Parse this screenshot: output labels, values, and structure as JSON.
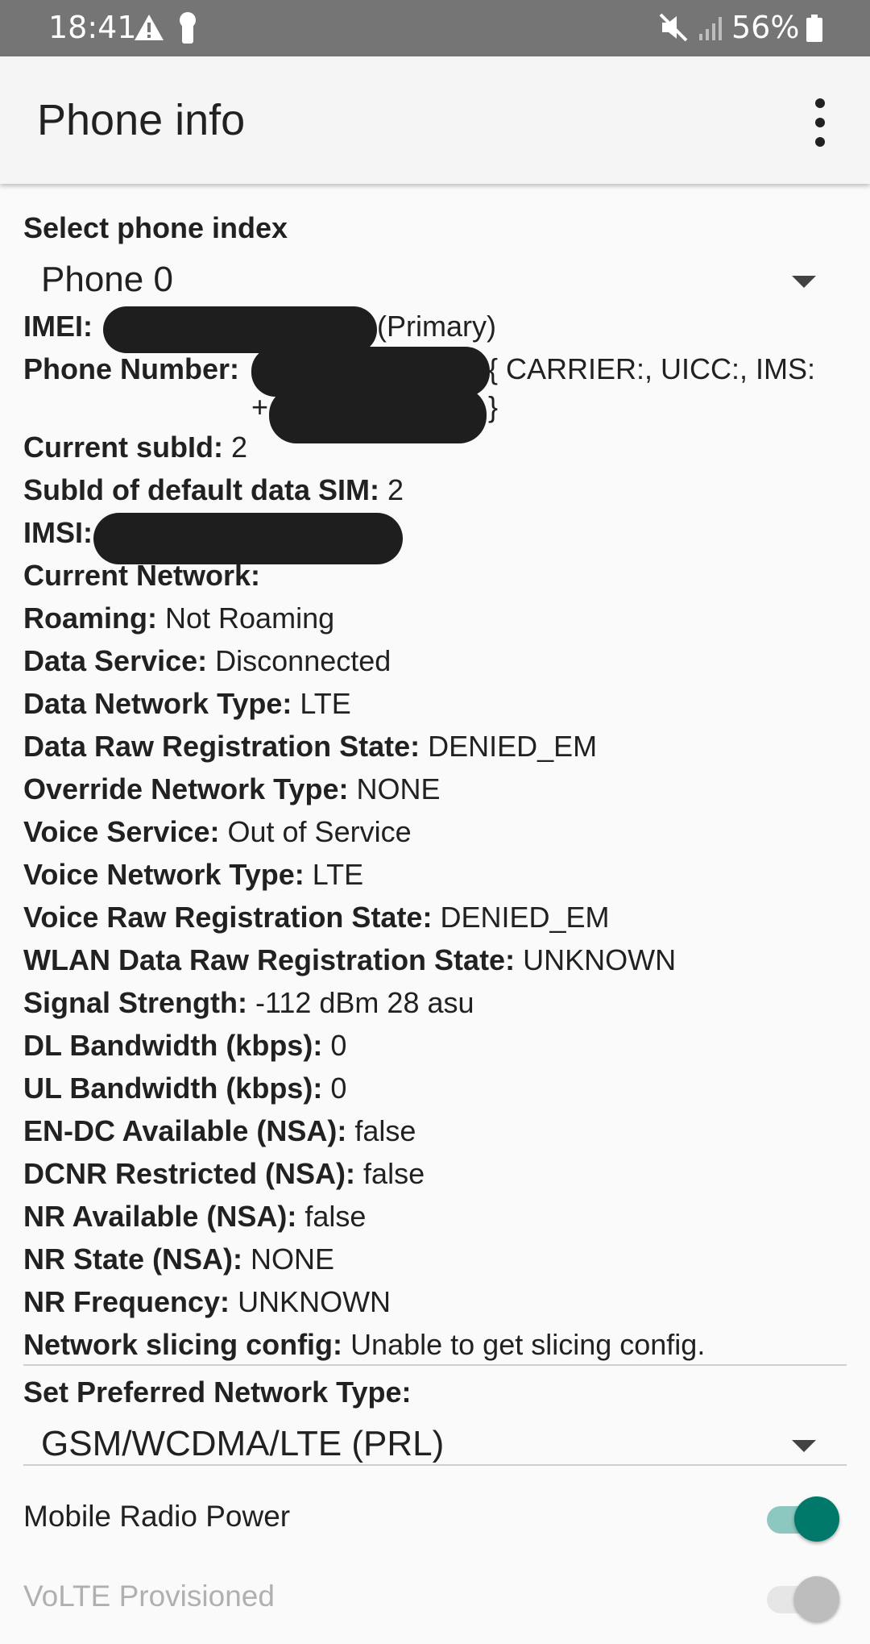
{
  "status_bar": {
    "time": "18:41",
    "battery": "56%",
    "icons": [
      "alert-icon",
      "bulb-icon",
      "mute-icon",
      "signal-icon",
      "battery-icon"
    ]
  },
  "app_bar": {
    "title": "Phone info",
    "menu_icon": "more-vert-icon"
  },
  "phone_index": {
    "label": "Select phone index",
    "selected": "Phone 0"
  },
  "imei": {
    "label": "IMEI:",
    "suffix": "(Primary)"
  },
  "phone_number": {
    "label": "Phone Number:",
    "suffix_line1": "{ CARRIER:, UICC:, IMS:",
    "prefix_line2": "+",
    "suffix_line2": "}"
  },
  "info_rows": [
    {
      "label": "Current subId:",
      "value": "2"
    },
    {
      "label": "SubId of default data SIM:",
      "value": "2"
    },
    {
      "label": "IMSI:",
      "value": ""
    },
    {
      "label": "Current Network:",
      "value": ""
    },
    {
      "label": "Roaming:",
      "value": "Not Roaming"
    },
    {
      "label": "Data Service:",
      "value": "Disconnected"
    },
    {
      "label": "Data Network Type:",
      "value": "LTE"
    },
    {
      "label": "Data Raw Registration State:",
      "value": "DENIED_EM"
    },
    {
      "label": "Override Network Type:",
      "value": "NONE"
    },
    {
      "label": "Voice Service:",
      "value": "Out of Service"
    },
    {
      "label": "Voice Network Type:",
      "value": "LTE"
    },
    {
      "label": "Voice Raw Registration State:",
      "value": "DENIED_EM"
    },
    {
      "label": "WLAN Data Raw Registration State:",
      "value": "UNKNOWN"
    },
    {
      "label": "Signal Strength:",
      "value": "-112 dBm   28 asu"
    },
    {
      "label": "DL Bandwidth (kbps):",
      "value": "0"
    },
    {
      "label": "UL Bandwidth (kbps):",
      "value": "0"
    },
    {
      "label": "EN-DC Available (NSA):",
      "value": "false"
    },
    {
      "label": "DCNR Restricted (NSA):",
      "value": "false"
    },
    {
      "label": "NR Available (NSA):",
      "value": "false"
    },
    {
      "label": "NR State (NSA):",
      "value": "NONE"
    },
    {
      "label": "NR Frequency:",
      "value": "UNKNOWN"
    },
    {
      "label": "Network slicing config:",
      "value": "Unable to get slicing config."
    }
  ],
  "preferred_network": {
    "label": "Set Preferred Network Type:",
    "selected": "GSM/WCDMA/LTE (PRL)"
  },
  "switches": [
    {
      "label": "Mobile Radio Power",
      "on": true,
      "enabled": true
    },
    {
      "label": "VoLTE Provisioned",
      "on": false,
      "enabled": false
    }
  ],
  "colors": {
    "accent": "#00796b",
    "accent_track": "#8cc7c0",
    "status_bar": "#757575",
    "disabled_text": "#b0b0b0"
  }
}
